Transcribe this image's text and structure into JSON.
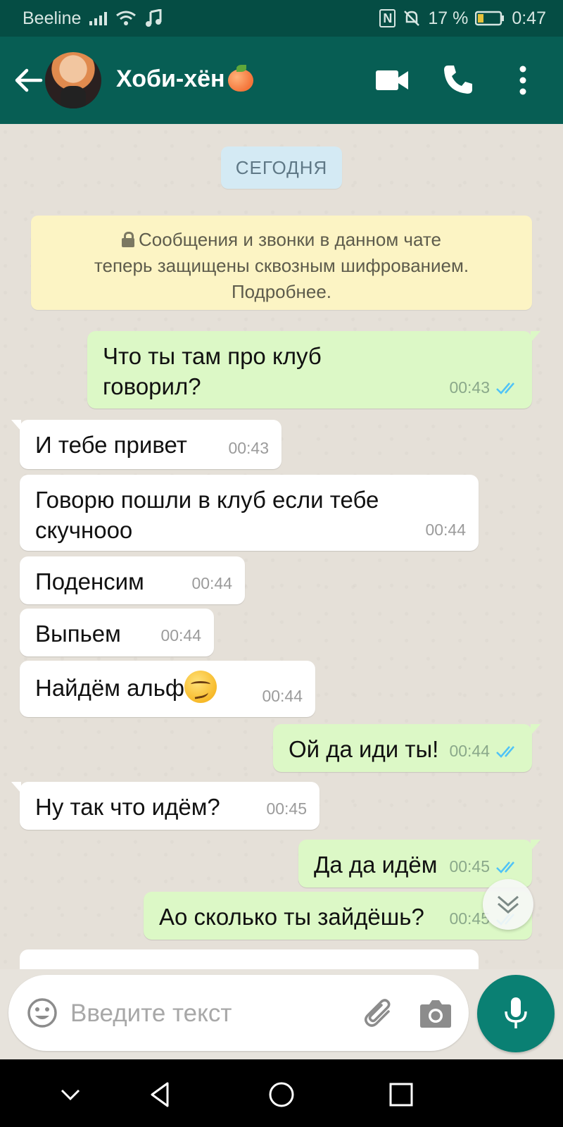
{
  "status_bar": {
    "carrier": "Beeline",
    "nfc_label": "N",
    "battery_percent": "17 %",
    "time": "0:47"
  },
  "header": {
    "contact_name": "Хоби-хён",
    "icons": [
      "back-arrow-icon",
      "avatar",
      "video-call-icon",
      "phone-call-icon",
      "more-options-icon"
    ]
  },
  "chat": {
    "date_chip": "СЕГОДНЯ",
    "encryption_notice": "Сообщения и звонки в данном чате\nтеперь защищены сквозным шифрованием.\nПодробнее.",
    "messages": [
      {
        "direction": "out",
        "text": "Что ты там про клуб\nговорил?",
        "time": "00:43",
        "status": "read"
      },
      {
        "direction": "in",
        "text": "И тебе привет",
        "time": "00:43"
      },
      {
        "direction": "in",
        "text": "Говорю пошли в клуб если тебе\nскучнооо",
        "time": "00:44"
      },
      {
        "direction": "in",
        "text": "Поденсим",
        "time": "00:44"
      },
      {
        "direction": "in",
        "text": "Выпьем",
        "time": "00:44"
      },
      {
        "direction": "in",
        "text": "Найдём альф",
        "emoji": "smirking-face",
        "time": "00:44"
      },
      {
        "direction": "out",
        "text": "Ой да иди ты!",
        "time": "00:44",
        "status": "read"
      },
      {
        "direction": "in",
        "text": "Ну так что идём?",
        "time": "00:45"
      },
      {
        "direction": "out",
        "text": "Да да идём",
        "time": "00:45",
        "status": "read"
      },
      {
        "direction": "out",
        "text": "Ао сколько ты зайдёшь?",
        "time": "00:45",
        "status": "read"
      }
    ]
  },
  "composer": {
    "placeholder": "Введите текст"
  },
  "colors": {
    "header": "#075e54",
    "status_bar": "#054d44",
    "outgoing_bubble": "#dcf8c6",
    "incoming_bubble": "#ffffff",
    "read_ticks": "#4fc3f7",
    "mic_button": "#0a8073"
  }
}
